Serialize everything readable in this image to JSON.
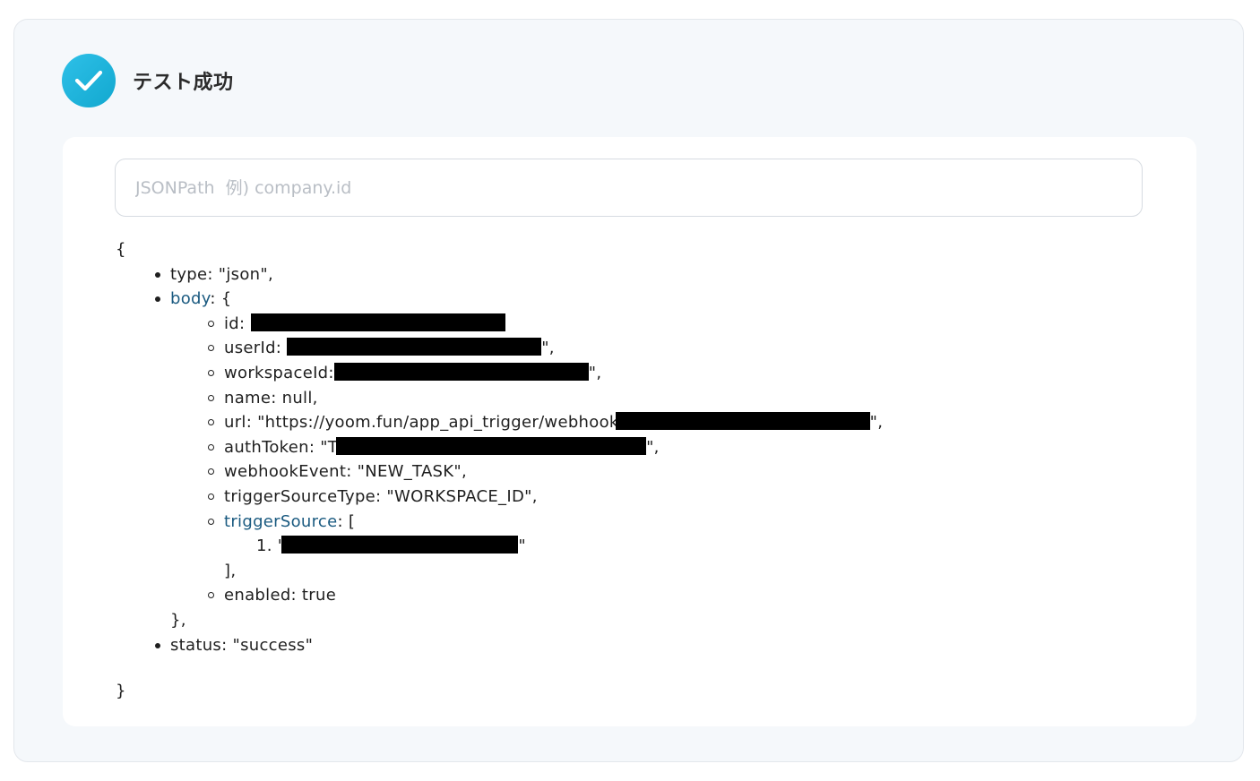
{
  "header": {
    "title": "テスト成功",
    "icon": "check-circle-icon",
    "icon_color": "#1fb4de"
  },
  "search": {
    "placeholder": "JSONPath  例) company.id",
    "value": ""
  },
  "json_tree": {
    "open_brace": "{",
    "close_brace": "}",
    "type_line": "type: \"json\",",
    "body_key": "body",
    "body_open": ": {",
    "id_prefix": "id: \"",
    "id_suffix": "",
    "userId_prefix": "userId:",
    "userId_suffix": "\",",
    "workspaceId_prefix": "workspaceId:",
    "workspaceId_suffix": "\",",
    "name_line": "name: null,",
    "url_prefix": "url: \"https://yoom.fun/app_api_trigger/webhook",
    "url_suffix": "\",",
    "authToken_prefix": "authToken: \"T",
    "authToken_suffix": "\",",
    "webhookEvent_line": "webhookEvent: \"NEW_TASK\",",
    "triggerSourceType_line": "triggerSourceType: \"WORKSPACE_ID\",",
    "triggerSource_key": "triggerSource",
    "triggerSource_open": ": [",
    "triggerSource_item_prefix": "1. \"",
    "triggerSource_item_suffix": "\"",
    "triggerSource_close": "],",
    "enabled_line": "enabled: true",
    "body_close": "},",
    "status_line": "status: \"success\""
  }
}
